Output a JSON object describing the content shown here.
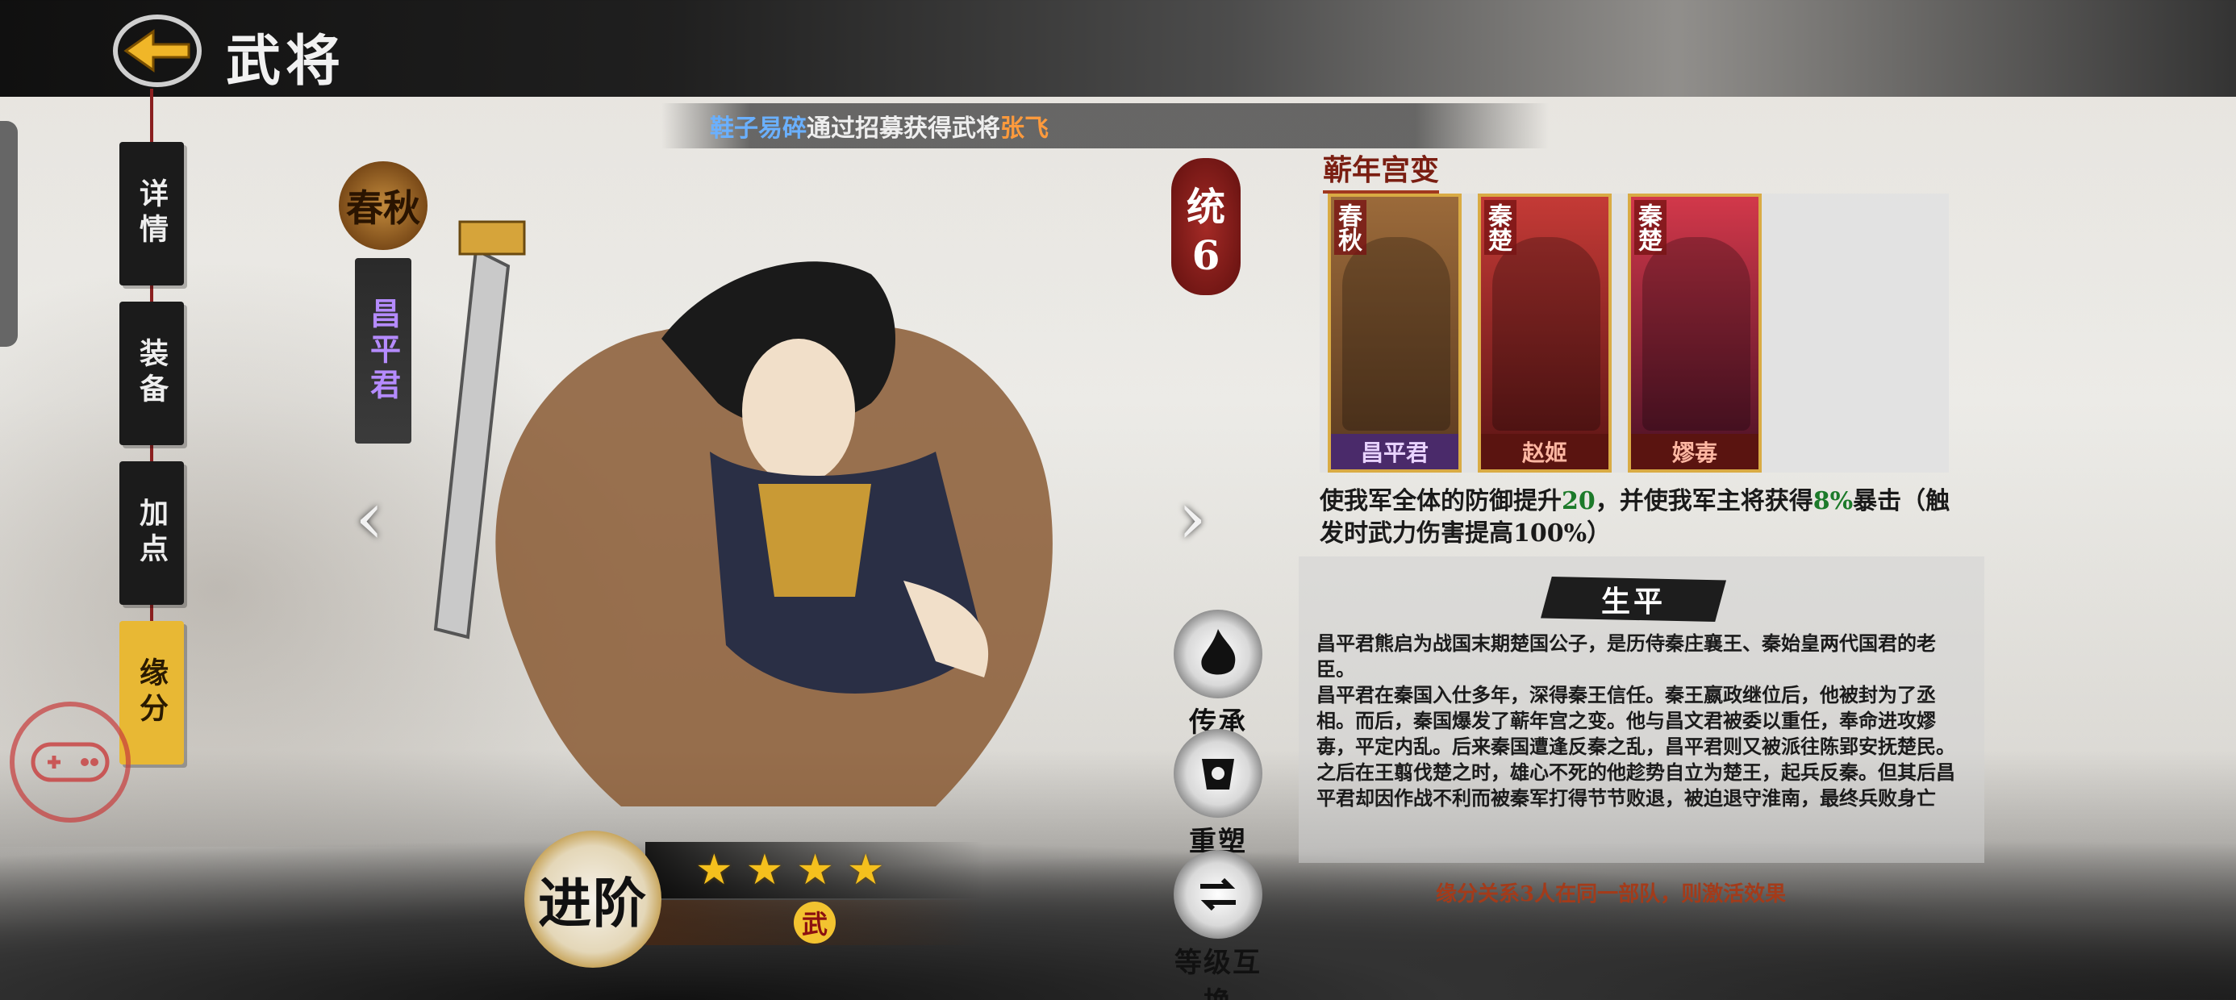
{
  "header": {
    "title": "武将",
    "notice": {
      "player": "鞋子易碎",
      "text": "通过招募获得武将",
      "hero": "张飞"
    }
  },
  "tabs": [
    {
      "label": "详情",
      "active": false
    },
    {
      "label": "装备",
      "active": false
    },
    {
      "label": "加点",
      "active": false
    },
    {
      "label": "缘分",
      "active": true
    }
  ],
  "hero": {
    "faction": "春秋",
    "name": "昌平君",
    "command_label": "统",
    "command_value": "6",
    "stars": 4,
    "type": "武",
    "advance_label": "进阶"
  },
  "actions": [
    {
      "label": "传承",
      "icon": "flame-icon"
    },
    {
      "label": "重塑",
      "icon": "armor-icon"
    },
    {
      "label": "等级互换",
      "icon": "swap-icon"
    }
  ],
  "bond": {
    "title": "蕲年宫变",
    "cards": [
      {
        "faction": "春秋",
        "name": "昌平君"
      },
      {
        "faction": "秦楚",
        "name": "赵姬"
      },
      {
        "faction": "秦楚",
        "name": "嫪毐"
      }
    ],
    "desc_a": "使我军全体的防御提升",
    "desc_v1": "20",
    "desc_b": "，并使我军主将获得",
    "desc_v2": "8%",
    "desc_c": "暴击（触发时武力伤害提高100%）",
    "hint": "缘分关系3人在同一部队，则激活效果"
  },
  "biography": {
    "title": "生平",
    "text": "昌平君熊启为战国末期楚国公子，是历侍秦庄襄王、秦始皇两代国君的老臣。\n昌平君在秦国入仕多年，深得秦王信任。秦王嬴政继位后，他被封为了丞相。而后，秦国爆发了蕲年宫之变。他与昌文君被委以重任，奉命进攻嫪毐，平定内乱。后来秦国遭逢反秦之乱，昌平君则又被派往陈郢安抚楚民。之后在王翦伐楚之时，雄心不死的他趁势自立为楚王，起兵反秦。但其后昌平君却因作战不利而被秦军打得节节败退，被迫退守淮南，最终兵败身亡"
  },
  "colors": {
    "accent_gold": "#f5c01d",
    "bond_title": "#7a1e12",
    "value_green": "#1c7a2a",
    "hint_red": "#a33b1a",
    "name_purple": "#b58bff"
  }
}
